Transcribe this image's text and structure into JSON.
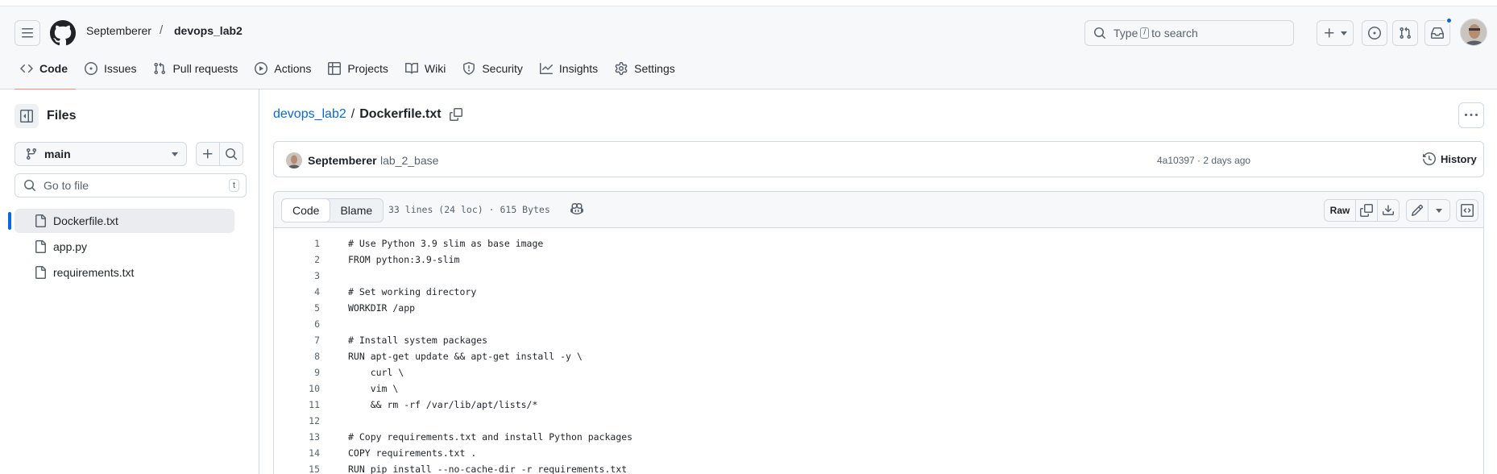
{
  "header": {
    "owner": "Septemberer",
    "separator": "/",
    "repo": "devops_lab2",
    "search": {
      "prefix": "Type",
      "key": "/",
      "suffix": "to search"
    },
    "tabs": [
      {
        "label": "Code",
        "icon": "code-icon"
      },
      {
        "label": "Issues",
        "icon": "issue-icon"
      },
      {
        "label": "Pull requests",
        "icon": "git-pull-request-icon"
      },
      {
        "label": "Actions",
        "icon": "play-icon"
      },
      {
        "label": "Projects",
        "icon": "table-icon"
      },
      {
        "label": "Wiki",
        "icon": "book-icon"
      },
      {
        "label": "Security",
        "icon": "shield-icon"
      },
      {
        "label": "Insights",
        "icon": "graph-icon"
      },
      {
        "label": "Settings",
        "icon": "gear-icon"
      }
    ],
    "selected_tab": "Code"
  },
  "sidebar": {
    "title": "Files",
    "branch": "main",
    "goto_placeholder": "Go to file",
    "goto_key": "t",
    "files": [
      {
        "name": "Dockerfile.txt",
        "active": true
      },
      {
        "name": "app.py",
        "active": false
      },
      {
        "name": "requirements.txt",
        "active": false
      }
    ]
  },
  "main": {
    "path_repo": "devops_lab2",
    "path_sep": "/",
    "path_file": "Dockerfile.txt",
    "commit": {
      "author": "Septemberer",
      "message": "lab_2_base",
      "meta": "4a10397 · 2 days ago",
      "history_label": "History"
    },
    "toolbar": {
      "code_label": "Code",
      "blame_label": "Blame",
      "file_info": "33 lines (24 loc) · 615 Bytes",
      "raw_label": "Raw"
    },
    "lines": [
      {
        "n": "1",
        "text": "# Use Python 3.9 slim as base image"
      },
      {
        "n": "2",
        "text": "FROM python:3.9-slim"
      },
      {
        "n": "3",
        "text": ""
      },
      {
        "n": "4",
        "text": "# Set working directory"
      },
      {
        "n": "5",
        "text": "WORKDIR /app"
      },
      {
        "n": "6",
        "text": ""
      },
      {
        "n": "7",
        "text": "# Install system packages"
      },
      {
        "n": "8",
        "text": "RUN apt-get update && apt-get install -y \\"
      },
      {
        "n": "9",
        "text": "    curl \\"
      },
      {
        "n": "10",
        "text": "    vim \\"
      },
      {
        "n": "11",
        "text": "    && rm -rf /var/lib/apt/lists/*"
      },
      {
        "n": "12",
        "text": ""
      },
      {
        "n": "13",
        "text": "# Copy requirements.txt and install Python packages"
      },
      {
        "n": "14",
        "text": "COPY requirements.txt ."
      },
      {
        "n": "15",
        "text": "RUN pip install --no-cache-dir -r requirements.txt"
      }
    ]
  },
  "colors": {
    "accent": "#0969da",
    "tab_underline": "#fd8c73",
    "header_bg": "#f6f8fa",
    "border": "#d1d9e0"
  }
}
